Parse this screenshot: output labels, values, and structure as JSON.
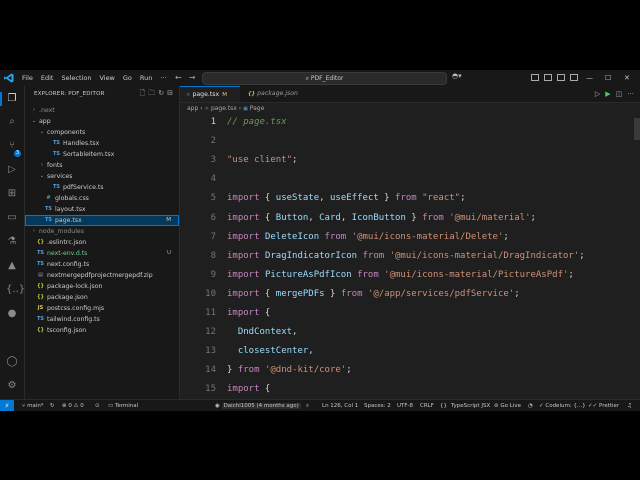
{
  "app": {
    "search_box": "PDF_Editor",
    "menu": [
      "File",
      "Edit",
      "Selection",
      "View",
      "Go",
      "Run"
    ],
    "window_controls": [
      "—",
      "☐",
      "✕"
    ]
  },
  "explorer": {
    "header": "EXPLORER: PDF_EDITOR",
    "tree": [
      {
        "name": ".next",
        "depth": 0,
        "chevron": "›",
        "icon": "",
        "muted": true
      },
      {
        "name": "app",
        "depth": 0,
        "chevron": "⌄",
        "icon": ""
      },
      {
        "name": "components",
        "depth": 1,
        "chevron": "⌄",
        "icon": ""
      },
      {
        "name": "Handles.tsx",
        "depth": 2,
        "chevron": "",
        "icon": "ts"
      },
      {
        "name": "SortableItem.tsx",
        "depth": 2,
        "chevron": "",
        "icon": "ts"
      },
      {
        "name": "fonts",
        "depth": 1,
        "chevron": "›",
        "icon": ""
      },
      {
        "name": "services",
        "depth": 1,
        "chevron": "⌄",
        "icon": ""
      },
      {
        "name": "pdfService.ts",
        "depth": 2,
        "chevron": "",
        "icon": "ts"
      },
      {
        "name": "globals.css",
        "depth": 1,
        "chevron": "",
        "icon": "css"
      },
      {
        "name": "layout.tsx",
        "depth": 1,
        "chevron": "",
        "icon": "ts"
      },
      {
        "name": "page.tsx",
        "depth": 1,
        "chevron": "",
        "icon": "ts",
        "status": "M",
        "selected": true
      },
      {
        "name": "node_modules",
        "depth": 0,
        "chevron": "›",
        "icon": "",
        "muted": true
      },
      {
        "name": ".eslintrc.json",
        "depth": 0,
        "chevron": "",
        "icon": "json"
      },
      {
        "name": "next-env.d.ts",
        "depth": 0,
        "chevron": "",
        "icon": "ts",
        "status": "U"
      },
      {
        "name": "next.config.ts",
        "depth": 0,
        "chevron": "",
        "icon": "ts"
      },
      {
        "name": "nextmergepdfprojectmergepdf.zip",
        "depth": 0,
        "chevron": "",
        "icon": "zip"
      },
      {
        "name": "package-lock.json",
        "depth": 0,
        "chevron": "",
        "icon": "json"
      },
      {
        "name": "package.json",
        "depth": 0,
        "chevron": "",
        "icon": "json"
      },
      {
        "name": "postcss.config.mjs",
        "depth": 0,
        "chevron": "",
        "icon": "js"
      },
      {
        "name": "tailwind.config.ts",
        "depth": 0,
        "chevron": "",
        "icon": "ts"
      },
      {
        "name": "tsconfig.json",
        "depth": 0,
        "chevron": "",
        "icon": "json"
      }
    ]
  },
  "tabs": [
    {
      "label": "page.tsx",
      "marker": "M",
      "active": true
    },
    {
      "label": "package.json",
      "marker": "",
      "active": false
    }
  ],
  "breadcrumb": [
    "app",
    "page.tsx",
    "Page"
  ],
  "code_lines": [
    {
      "n": "1",
      "tokens": [
        [
          "c",
          "// page.tsx"
        ]
      ]
    },
    {
      "n": "2",
      "tokens": []
    },
    {
      "n": "3",
      "tokens": [
        [
          "s",
          "\"use client\""
        ],
        [
          "p",
          ";"
        ]
      ]
    },
    {
      "n": "4",
      "tokens": []
    },
    {
      "n": "5",
      "tokens": [
        [
          "k",
          "import"
        ],
        [
          "p",
          " { "
        ],
        [
          "v",
          "useState"
        ],
        [
          "p",
          ", "
        ],
        [
          "v",
          "useEffect"
        ],
        [
          "p",
          " } "
        ],
        [
          "k",
          "from"
        ],
        [
          "p",
          " "
        ],
        [
          "s",
          "\"react\""
        ],
        [
          "p",
          ";"
        ]
      ]
    },
    {
      "n": "6",
      "tokens": [
        [
          "k",
          "import"
        ],
        [
          "p",
          " { "
        ],
        [
          "v",
          "Button"
        ],
        [
          "p",
          ", "
        ],
        [
          "v",
          "Card"
        ],
        [
          "p",
          ", "
        ],
        [
          "v",
          "IconButton"
        ],
        [
          "p",
          " } "
        ],
        [
          "k",
          "from"
        ],
        [
          "p",
          " "
        ],
        [
          "s",
          "'@mui/material'"
        ],
        [
          "p",
          ";"
        ]
      ]
    },
    {
      "n": "7",
      "tokens": [
        [
          "k",
          "import"
        ],
        [
          "p",
          " "
        ],
        [
          "v",
          "DeleteIcon"
        ],
        [
          "p",
          " "
        ],
        [
          "k",
          "from"
        ],
        [
          "p",
          " "
        ],
        [
          "s",
          "'@mui/icons-material/Delete'"
        ],
        [
          "p",
          ";"
        ]
      ]
    },
    {
      "n": "8",
      "tokens": [
        [
          "k",
          "import"
        ],
        [
          "p",
          " "
        ],
        [
          "v",
          "DragIndicatorIcon"
        ],
        [
          "p",
          " "
        ],
        [
          "k",
          "from"
        ],
        [
          "p",
          " "
        ],
        [
          "s",
          "'@mui/icons-material/DragIndicator'"
        ],
        [
          "p",
          ";"
        ]
      ]
    },
    {
      "n": "9",
      "tokens": [
        [
          "k",
          "import"
        ],
        [
          "p",
          " "
        ],
        [
          "v",
          "PictureAsPdfIcon"
        ],
        [
          "p",
          " "
        ],
        [
          "k",
          "from"
        ],
        [
          "p",
          " "
        ],
        [
          "s",
          "'@mui/icons-material/PictureAsPdf'"
        ],
        [
          "p",
          ";"
        ]
      ]
    },
    {
      "n": "10",
      "tokens": [
        [
          "k",
          "import"
        ],
        [
          "p",
          " { "
        ],
        [
          "v",
          "mergePDFs"
        ],
        [
          "p",
          " } "
        ],
        [
          "k",
          "from"
        ],
        [
          "p",
          " "
        ],
        [
          "s",
          "'@/app/services/pdfService'"
        ],
        [
          "p",
          ";"
        ]
      ]
    },
    {
      "n": "11",
      "tokens": [
        [
          "k",
          "import"
        ],
        [
          "p",
          " {"
        ]
      ]
    },
    {
      "n": "12",
      "tokens": [
        [
          "p",
          "  "
        ],
        [
          "v",
          "DndContext"
        ],
        [
          "p",
          ","
        ]
      ]
    },
    {
      "n": "13",
      "tokens": [
        [
          "p",
          "  "
        ],
        [
          "v",
          "closestCenter"
        ],
        [
          "p",
          ","
        ]
      ]
    },
    {
      "n": "14",
      "tokens": [
        [
          "p",
          "} "
        ],
        [
          "k",
          "from"
        ],
        [
          "p",
          " "
        ],
        [
          "s",
          "'@dnd-kit/core'"
        ],
        [
          "p",
          ";"
        ]
      ]
    },
    {
      "n": "15",
      "tokens": [
        [
          "k",
          "import"
        ],
        [
          "p",
          " {"
        ]
      ]
    }
  ],
  "status_bar": {
    "branch": "main*",
    "errors": "0",
    "warnings": "0",
    "terminal": "Terminal",
    "blame": "Daichi1005 (4 months ago)",
    "position": "Ln 126, Col 1",
    "spaces": "Spaces: 2",
    "encoding": "UTF-8",
    "eol": "CRLF",
    "language": "TypeScript JSX",
    "golive": "Go Live",
    "codeium": "Codeium: {...}",
    "prettier": "Prettier"
  },
  "colors": {
    "accent": "#0078d4",
    "editor_bg": "#1f1f1f",
    "sidebar_bg": "#181818"
  }
}
